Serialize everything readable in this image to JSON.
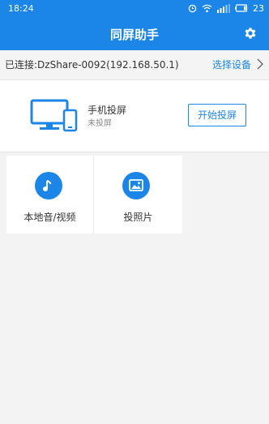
{
  "status": {
    "time": "18:24",
    "battery": "23"
  },
  "header": {
    "title": "同屏助手"
  },
  "connection": {
    "text": "已连接:DzShare-0092(192.168.50.1)",
    "choose_label": "选择设备"
  },
  "cast": {
    "title": "手机投屏",
    "subtitle": "未投屏",
    "start_label": "开始投屏"
  },
  "features": [
    {
      "label": "本地音/视频",
      "icon": "music-note-icon"
    },
    {
      "label": "投照片",
      "icon": "photo-icon"
    }
  ],
  "colors": {
    "accent": "#1b86e7",
    "background": "#f3f3f3"
  }
}
